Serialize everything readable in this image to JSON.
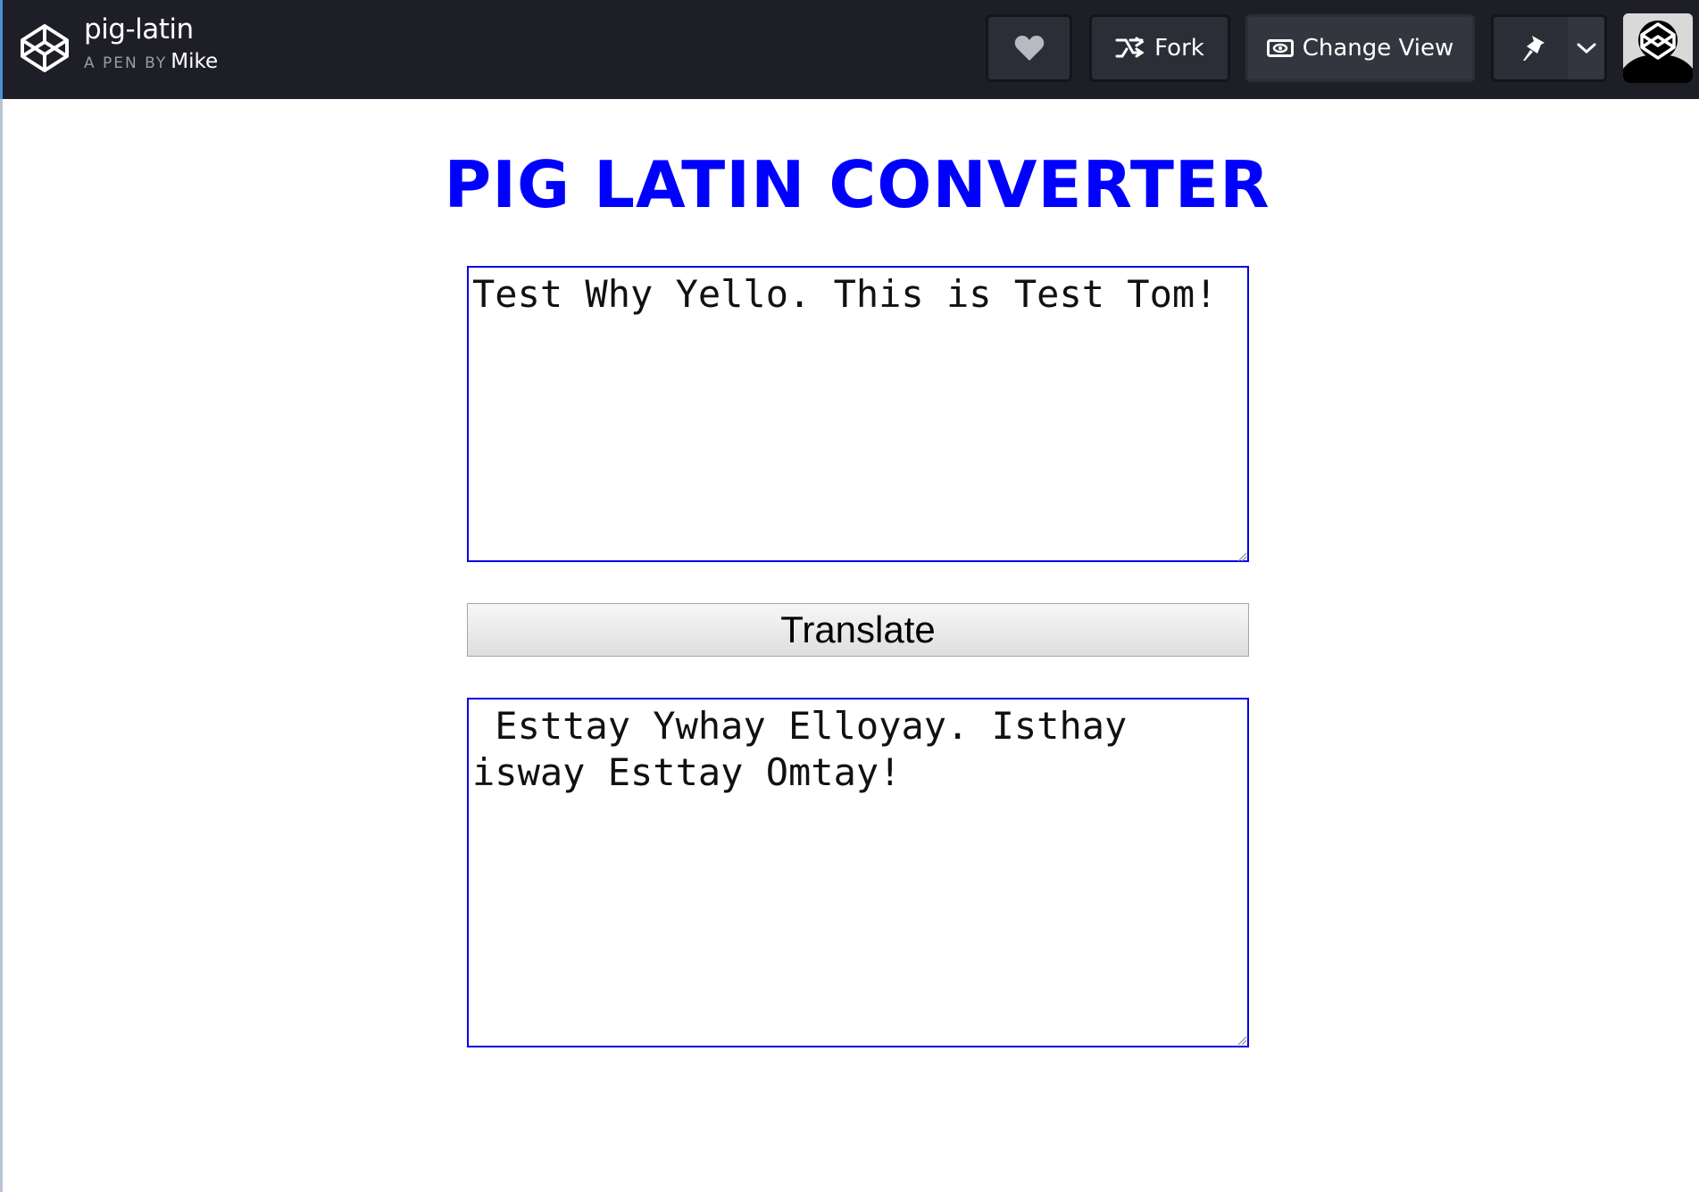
{
  "header": {
    "pen_title": "pig-latin",
    "by_label": "A PEN BY",
    "author": "Mike",
    "fork_label": "Fork",
    "change_view_label": "Change View",
    "icons": {
      "logo": "codepen-logo-icon",
      "like": "heart-icon",
      "fork": "fork-icon",
      "view": "eye-icon",
      "pin": "pin-icon",
      "caret": "chevron-down-icon"
    }
  },
  "main": {
    "heading": "PIG LATIN CONVERTER",
    "input_text": "Test Why Yello. This is Test Tom!",
    "translate_label": "Translate",
    "output_text": " Esttay Ywhay Elloyay. Isthay isway Esttay Omtay!"
  },
  "colors": {
    "topbar_bg": "#1e1f26",
    "heading": "#0000ff",
    "textarea_border": "#0000e6"
  }
}
